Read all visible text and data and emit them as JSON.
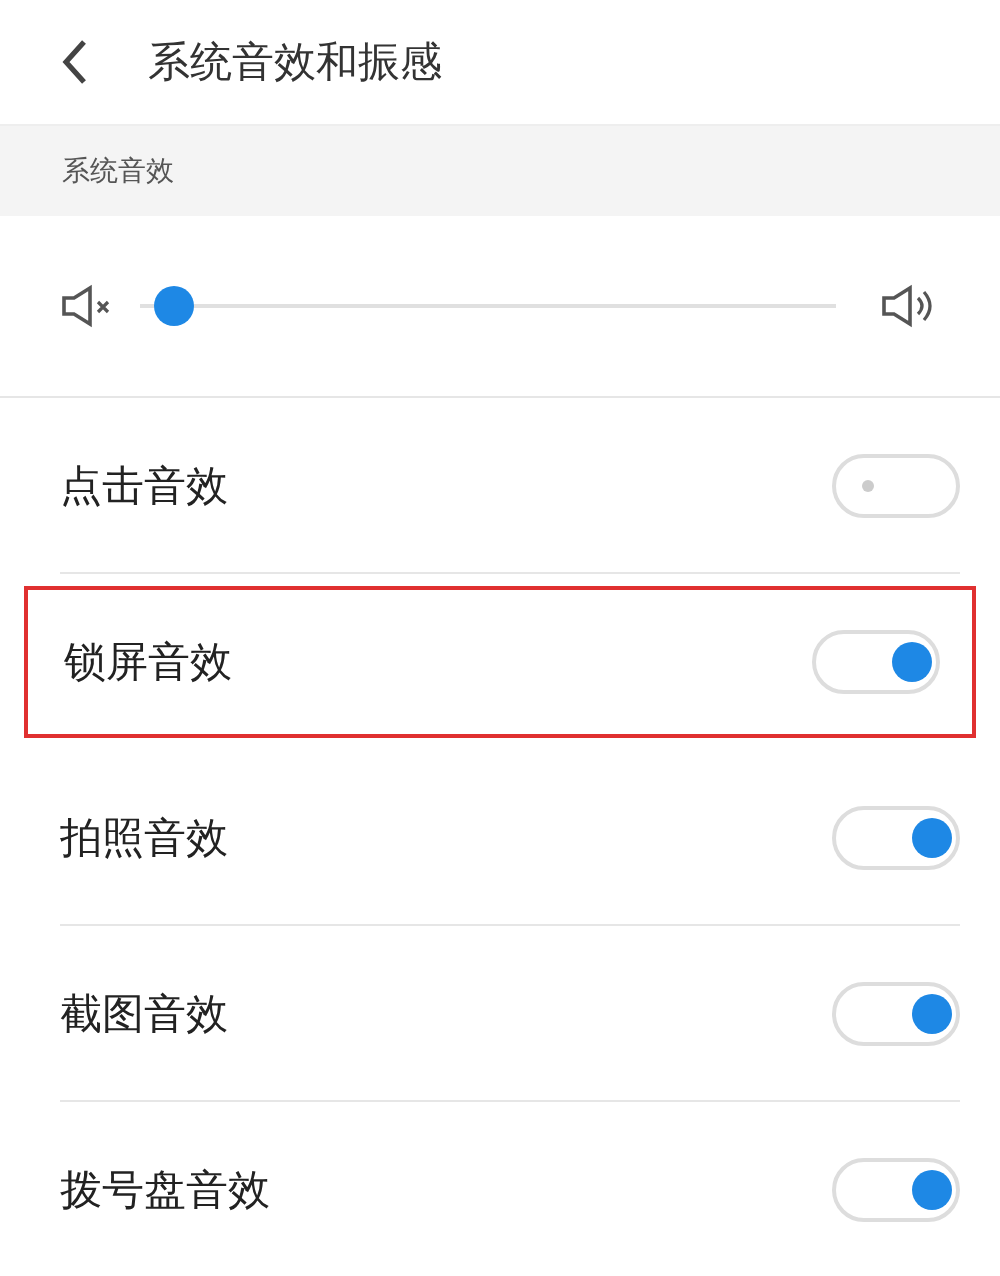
{
  "header": {
    "title": "系统音效和振感"
  },
  "section": {
    "title": "系统音效"
  },
  "volume": {
    "level": 0.02
  },
  "toggles": [
    {
      "label": "点击音效",
      "on": false,
      "highlighted": false
    },
    {
      "label": "锁屏音效",
      "on": true,
      "highlighted": true
    },
    {
      "label": "拍照音效",
      "on": true,
      "highlighted": false
    },
    {
      "label": "截图音效",
      "on": true,
      "highlighted": false
    },
    {
      "label": "拨号盘音效",
      "on": true,
      "highlighted": false
    }
  ]
}
